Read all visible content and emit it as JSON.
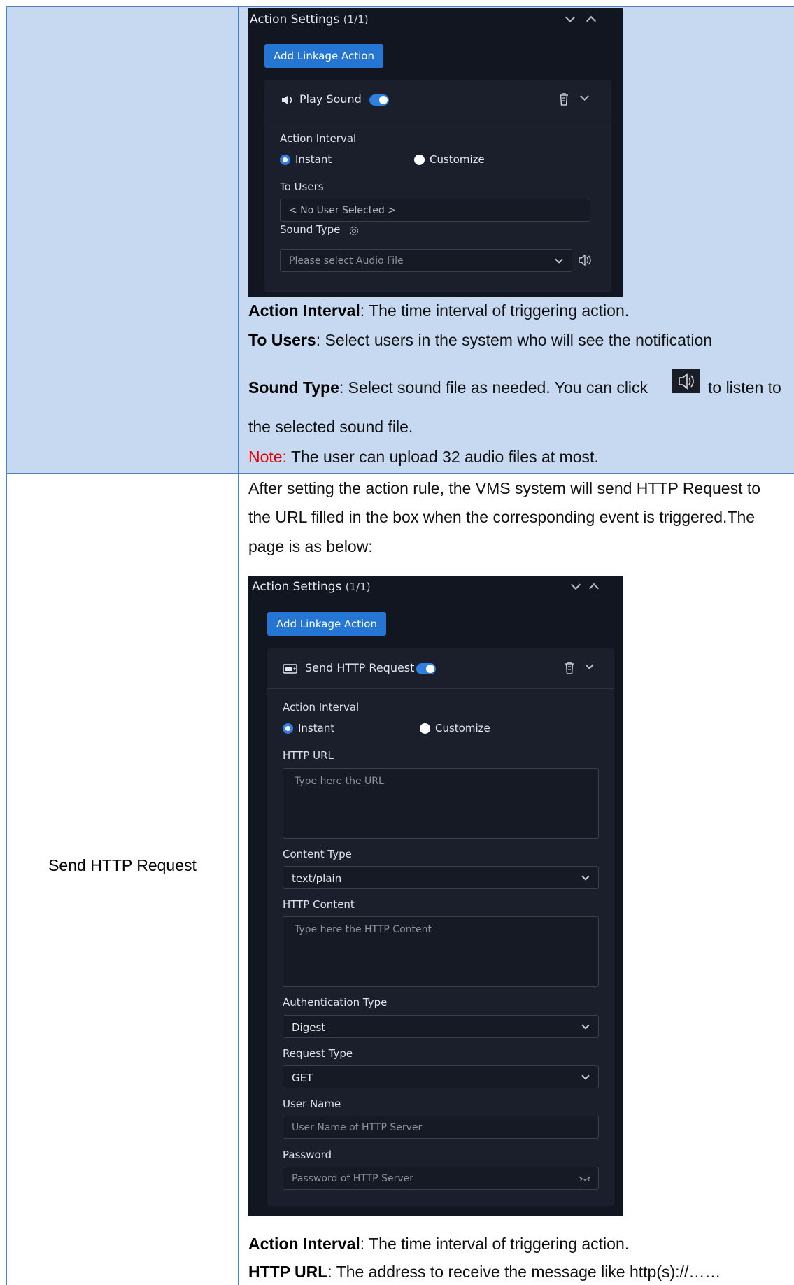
{
  "row1": {
    "panel": {
      "title": "Action Settings",
      "count": "(1/1)",
      "add_button": "Add Linkage Action",
      "card_title": "Play Sound",
      "action_interval_label": "Action Interval",
      "instant": "Instant",
      "customize": "Customize",
      "to_users_label": "To Users",
      "to_users_value": "< No User Selected >",
      "sound_type_label": "Sound Type",
      "sound_type_placeholder": "Please select Audio File"
    },
    "desc": {
      "action_interval_key": "Action Interval",
      "action_interval_text": ": The time interval of triggering action.",
      "to_users_key": "To Users",
      "to_users_text": ": Select users in the system who will see the notification",
      "sound_type_key": "Sound Type",
      "sound_type_text_1": ": Select sound file as needed. You can click",
      "sound_type_text_2": "to listen to",
      "sound_type_text_3": "the selected sound file.",
      "note_key": "Note:",
      "note_text": " The user can upload 32 audio files at most."
    }
  },
  "row2": {
    "label": "Send HTTP Request",
    "intro_1": "After setting the action rule, the VMS system will send HTTP Request to",
    "intro_2": "the URL filled in the box when the corresponding event is triggered.The",
    "intro_3": "page is as below:",
    "panel": {
      "title": "Action Settings",
      "count": "(1/1)",
      "add_button": "Add Linkage Action",
      "card_title": "Send HTTP Request",
      "action_interval_label": "Action Interval",
      "instant": "Instant",
      "customize": "Customize",
      "http_url_label": "HTTP URL",
      "http_url_placeholder": "Type here the URL",
      "content_type_label": "Content Type",
      "content_type_value": "text/plain",
      "http_content_label": "HTTP Content",
      "http_content_placeholder": "Type here the HTTP Content",
      "auth_type_label": "Authentication Type",
      "auth_type_value": "Digest",
      "request_type_label": "Request Type",
      "request_type_value": "GET",
      "user_name_label": "User Name",
      "user_name_placeholder": "User Name of HTTP Server",
      "password_label": "Password",
      "password_placeholder": "Password of HTTP Server"
    },
    "desc": {
      "action_interval_key": "Action Interval",
      "action_interval_text": ": The time interval of triggering action.",
      "http_url_key": "HTTP URL",
      "http_url_text": ": The address to receive the message like http(s)://……"
    }
  }
}
